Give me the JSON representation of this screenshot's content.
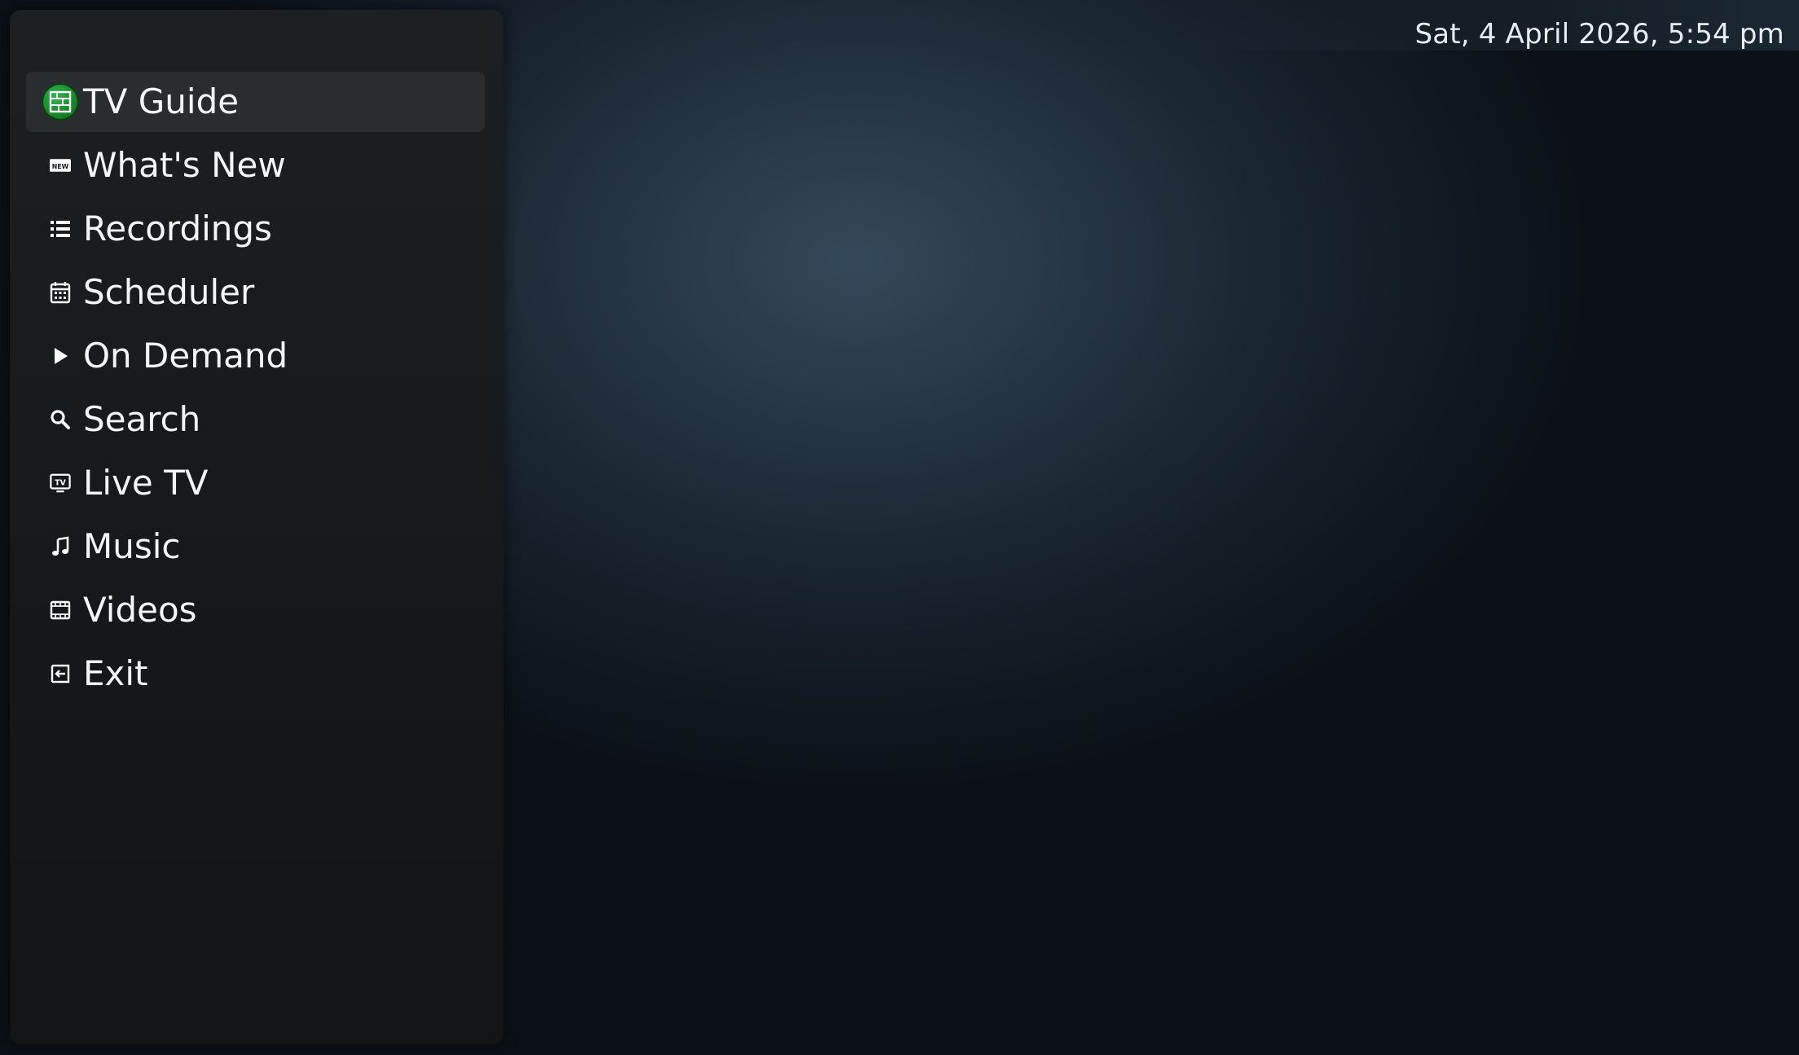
{
  "clock": {
    "text": "Sat, 4 April 2026, 5:54 pm"
  },
  "colors": {
    "sidebar_bg": "#161a1c",
    "selected_bg": "#2a2d2f",
    "accent_green": "#1f9a36",
    "text": "#f3f5f7"
  },
  "menu": {
    "selected_index": 0,
    "items": [
      {
        "label": "TV Guide",
        "icon": "tv-guide-grid-icon"
      },
      {
        "label": "What's New",
        "icon": "new-badge-icon"
      },
      {
        "label": "Recordings",
        "icon": "list-icon"
      },
      {
        "label": "Scheduler",
        "icon": "calendar-icon"
      },
      {
        "label": "On Demand",
        "icon": "play-icon"
      },
      {
        "label": "Search",
        "icon": "search-icon"
      },
      {
        "label": "Live TV",
        "icon": "live-tv-icon"
      },
      {
        "label": "Music",
        "icon": "music-note-icon"
      },
      {
        "label": "Videos",
        "icon": "film-icon"
      },
      {
        "label": "Exit",
        "icon": "exit-icon"
      }
    ]
  },
  "icons": {
    "new_badge_text": "NEW",
    "tv_badge_text": "TV"
  }
}
